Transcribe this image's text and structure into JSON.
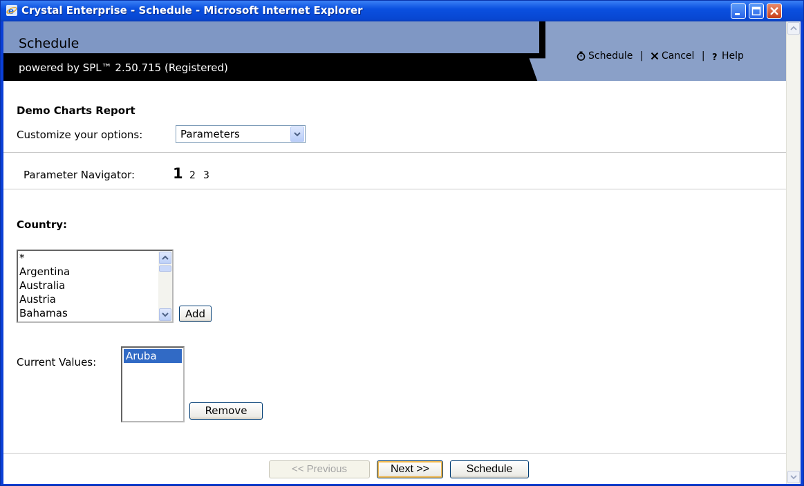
{
  "window": {
    "title": "Crystal Enterprise - Schedule - Microsoft Internet Explorer"
  },
  "header": {
    "app_title": "Schedule",
    "powered_by": "powered by SPL™ 2.50.715 (Registered)",
    "links": {
      "schedule": "Schedule",
      "cancel": "Cancel",
      "help": "Help",
      "separator": "|"
    }
  },
  "report": {
    "title": "Demo Charts Report",
    "customize_label": "Customize your options:",
    "options_selected": "Parameters"
  },
  "param_nav": {
    "label": "Parameter Navigator:",
    "pages": [
      "1",
      "2",
      "3"
    ],
    "current": "1"
  },
  "country": {
    "label": "Country:",
    "options": [
      "*",
      "Argentina",
      "Australia",
      "Austria",
      "Bahamas"
    ],
    "add_label": "Add"
  },
  "current_values": {
    "label": "Current Values:",
    "items": [
      "Aruba"
    ],
    "remove_label": "Remove"
  },
  "footer": {
    "previous_label": "<< Previous",
    "next_label": "Next >>",
    "schedule_label": "Schedule"
  },
  "colors": {
    "titlebar": "#0a50e0",
    "header_band": "#8aa0c8",
    "selection": "#316ac5",
    "disabled_text": "#a4a4a4"
  }
}
